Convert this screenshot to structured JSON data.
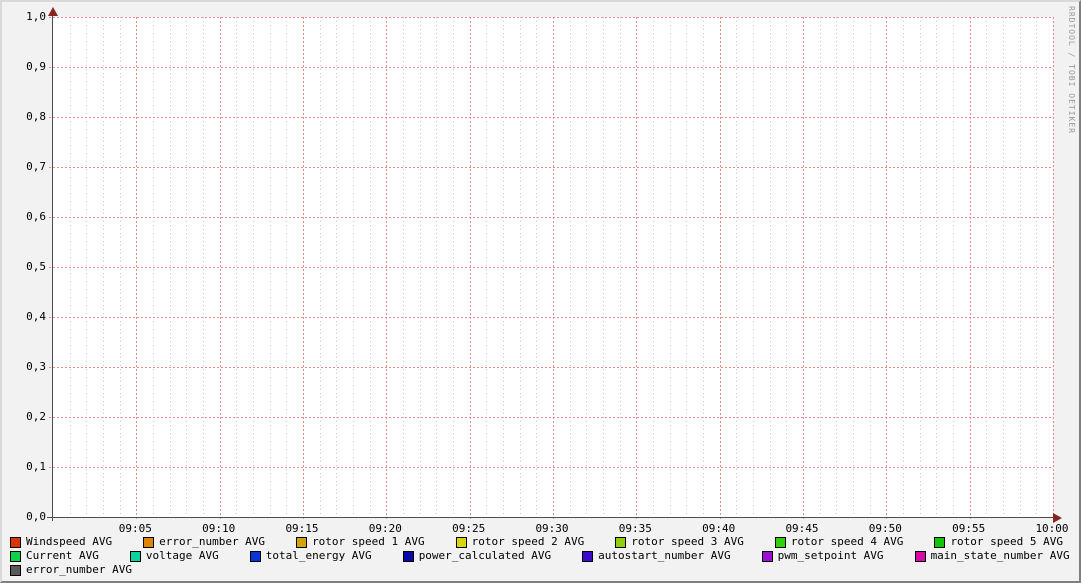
{
  "watermark": "RRDTOOL / TOBI OETIKER",
  "colors": {
    "background": "#F2F2F2",
    "canvas": "#FFFFFF",
    "axis": "#4D4D4D",
    "arrow": "#8B2420",
    "grid_minor": "#C8C8C8",
    "grid_major": "#E58E86",
    "text": "#000000",
    "watermark_text": "#999999"
  },
  "chart_data": {
    "type": "line",
    "title": "",
    "xlabel": "",
    "ylabel": "",
    "x_ticks": [
      "09:05",
      "09:10",
      "09:15",
      "09:20",
      "09:25",
      "09:30",
      "09:35",
      "09:40",
      "09:45",
      "09:50",
      "09:55",
      "10:00"
    ],
    "y_ticks": [
      "0,0",
      "0,1",
      "0,2",
      "0,3",
      "0,4",
      "0,5",
      "0,6",
      "0,7",
      "0,8",
      "0,9",
      "1,0"
    ],
    "ylim": [
      0,
      1
    ],
    "x_range_minutes": 60,
    "x_major_step_minutes": 5,
    "x_minor_step_minutes": 1,
    "grid": true,
    "legend_position": "bottom",
    "note": "empty graph - no data points plotted for any series",
    "series": [
      {
        "name": "Windspeed AVG",
        "color": "#D93608",
        "values": []
      },
      {
        "name": "error_number AVG",
        "color": "#DE8407",
        "values": []
      },
      {
        "name": "rotor speed 1 AVG",
        "color": "#CFA50B",
        "values": []
      },
      {
        "name": "rotor speed 2 AVG",
        "color": "#DAD60B",
        "values": []
      },
      {
        "name": "rotor speed 3 AVG",
        "color": "#8FD00B",
        "values": []
      },
      {
        "name": "rotor speed 4 AVG",
        "color": "#2FD30B",
        "values": []
      },
      {
        "name": "rotor speed 5 AVG",
        "color": "#14C40B",
        "values": []
      },
      {
        "name": "Current AVG",
        "color": "#0BD349",
        "values": []
      },
      {
        "name": "voltage AVG",
        "color": "#0CD39E",
        "values": []
      },
      {
        "name": "total_energy AVG",
        "color": "#0A36D6",
        "values": []
      },
      {
        "name": "power_calculated AVG",
        "color": "#0A0AA8",
        "values": []
      },
      {
        "name": "autostart_number AVG",
        "color": "#3A0ACD",
        "values": []
      },
      {
        "name": "pwm_setpoint AVG",
        "color": "#A00BD3",
        "values": []
      },
      {
        "name": "main_state_number AVG",
        "color": "#D60BA4",
        "values": []
      },
      {
        "name": "error_number AVG",
        "color": "#5A5A5A",
        "values": []
      }
    ],
    "legend_rows": [
      [
        0,
        1,
        2,
        3,
        4,
        5,
        6
      ],
      [
        7,
        8,
        9,
        10,
        11,
        12,
        13
      ],
      [
        14
      ]
    ]
  }
}
